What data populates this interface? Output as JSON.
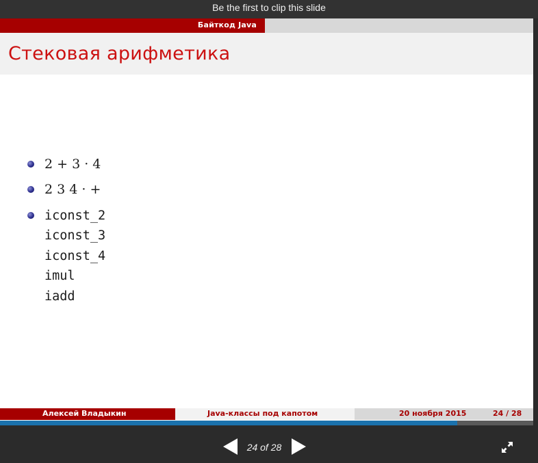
{
  "topbar": {
    "clip_text": "Be the first to clip this slide"
  },
  "slide": {
    "header_section": "Байткод Java",
    "title": "Стековая арифметика",
    "bullets": [
      {
        "type": "math",
        "text": "2 + 3 · 4"
      },
      {
        "type": "math",
        "text": "2 3 4 · +"
      },
      {
        "type": "code",
        "lines": [
          "iconst_2",
          "iconst_3",
          "iconst_4",
          "imul",
          "iadd"
        ]
      }
    ],
    "footer": {
      "author": "Алексей Владыкин",
      "talk_title": "Java-классы под капотом",
      "date": "20 ноября 2015",
      "page": "24 / 28"
    }
  },
  "colors": {
    "accent_red": "#a60000",
    "title_red": "#cc1111",
    "progress_blue": "#1b72ad"
  },
  "progress": {
    "current": 24,
    "total": 28
  },
  "nav": {
    "counter": "24 of 28",
    "prev_icon": "arrow-left-icon",
    "next_icon": "arrow-right-icon",
    "fullscreen_icon": "fullscreen-expand-icon"
  }
}
